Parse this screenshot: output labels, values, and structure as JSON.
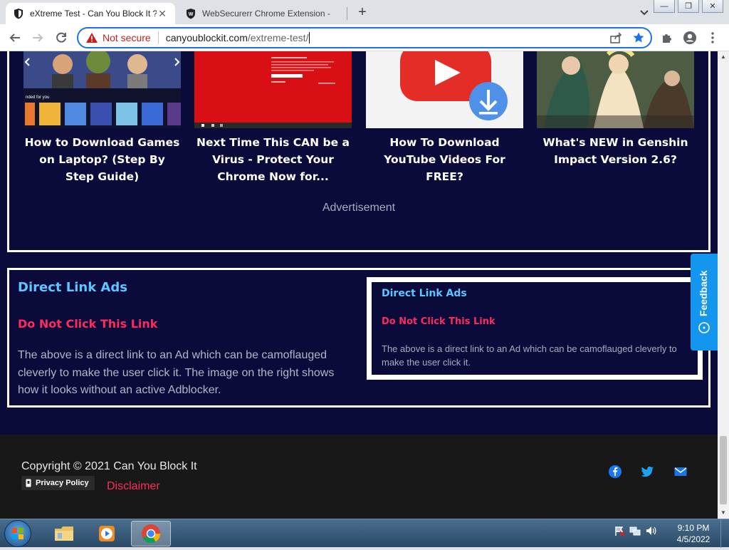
{
  "browser": {
    "tabs": [
      {
        "title": "eXtreme Test - Can You Block It ?",
        "active": true
      },
      {
        "title": "WebSecurerr Chrome Extension -",
        "active": false
      }
    ],
    "new_tab": "+",
    "window_buttons": {
      "minimize": "—",
      "restore": "❐",
      "close": "✕"
    },
    "omnibox": {
      "security_label": "Not secure",
      "url_host": "canyoublockit.com",
      "url_path": "/extreme-test/"
    }
  },
  "page": {
    "cards": [
      {
        "title": "How to Download Games on Laptop? (Step By Step Guide)"
      },
      {
        "title": "Next Time This CAN be a Virus - Protect Your Chrome Now for..."
      },
      {
        "title": "How To Download YouTube Videos For FREE?"
      },
      {
        "title": "What's NEW in Genshin Impact Version 2.6?"
      }
    ],
    "advertisement_label": "Advertisement",
    "direct_link": {
      "title": "Direct Link Ads",
      "link_text": "Do Not Click This Link",
      "description": "The above is a direct link to an Ad which can be camoflauged cleverly to make the user click it. The image on the right shows how it looks without an active Adblocker."
    },
    "direct_link_preview": {
      "title": "Direct Link Ads",
      "link_text": "Do Not Click This Link",
      "description": "The above is a direct link to an Ad which can be camoflauged cleverly to make the user click it."
    },
    "feedback_label": "Feedback",
    "footer": {
      "copyright": "Copyright © 2021 Can You Block It",
      "privacy_label": "Privacy Policy",
      "disclaimer_label": "Disclaimer",
      "social_icons": [
        "facebook-icon",
        "twitter-icon",
        "email-icon"
      ]
    }
  },
  "taskbar": {
    "time": "9:10 PM",
    "date": "4/5/2022",
    "apps": [
      "file-explorer",
      "media-player",
      "chrome"
    ]
  },
  "colors": {
    "page_bg": "#0b0b3b",
    "accent_cyan": "#5cc6ff",
    "accent_red": "#ff2a5c",
    "feedback_blue": "#1495ee",
    "footer_bg": "#181818"
  }
}
